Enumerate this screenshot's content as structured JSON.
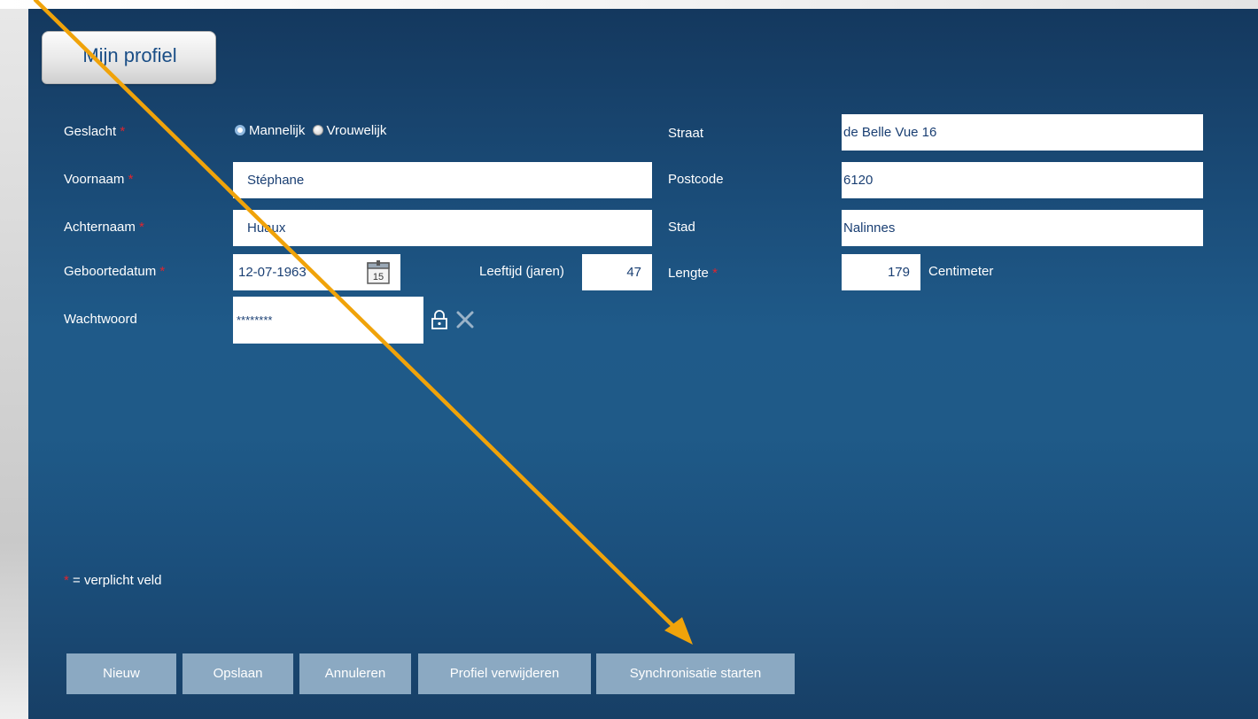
{
  "tab": {
    "label": "Mijn profiel"
  },
  "form": {
    "geslacht": {
      "label": "Geslacht",
      "options": [
        "Mannelijk",
        "Vrouwelijk"
      ],
      "selected": "Mannelijk"
    },
    "voornaam": {
      "label": "Voornaam",
      "value": "Stéphane"
    },
    "achternaam": {
      "label": "Achternaam",
      "value": "Huaux"
    },
    "geboortedatum": {
      "label": "Geboortedatum",
      "value": "12-07-1963",
      "calendar_day": "15"
    },
    "leeftijd": {
      "label": "Leeftijd (jaren)",
      "value": "47"
    },
    "wachtwoord": {
      "label": "Wachtwoord",
      "value": "********"
    },
    "straat": {
      "label": "Straat",
      "value": "de Belle Vue 16"
    },
    "postcode": {
      "label": "Postcode",
      "value": "6120"
    },
    "stad": {
      "label": "Stad",
      "value": "Nalinnes"
    },
    "lengte": {
      "label": "Lengte",
      "value": "179",
      "unit": "Centimeter"
    },
    "required_marker": "*"
  },
  "note": {
    "marker": "*",
    "text": "= verplicht veld"
  },
  "buttons": {
    "nieuw": "Nieuw",
    "opslaan": "Opslaan",
    "annuleren": "Annuleren",
    "verwijderen": "Profiel verwijderen",
    "synchronisatie": "Synchronisatie starten"
  },
  "colors": {
    "panel": "#1f5a89",
    "accent_text": "#1a3f73",
    "required": "#e0252e",
    "button": "#8ba9c2",
    "annotation_arrow": "#f0a30a"
  },
  "icons": [
    "calendar-icon",
    "lock-icon",
    "clear-icon",
    "radio-selected-icon",
    "radio-unselected-icon"
  ]
}
